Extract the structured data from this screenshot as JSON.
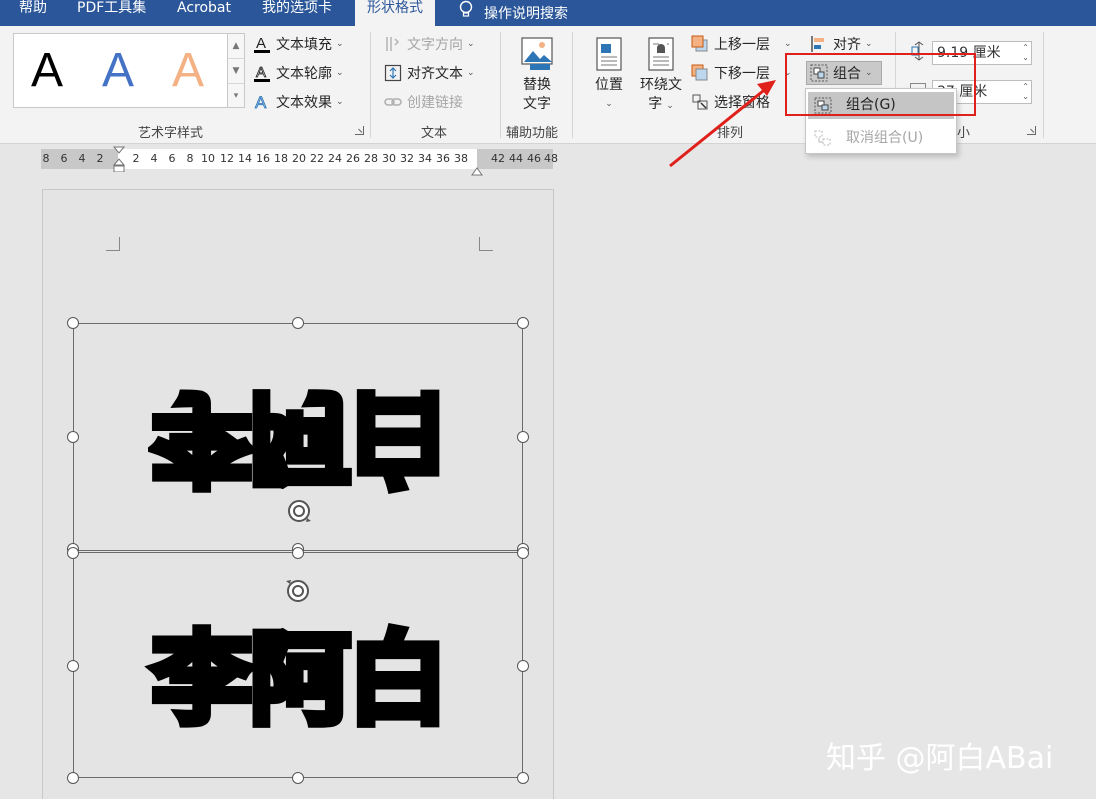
{
  "tabs": [
    {
      "label": "帮助"
    },
    {
      "label": "PDF工具集"
    },
    {
      "label": "Acrobat"
    },
    {
      "label": "我的选项卡"
    },
    {
      "label": "形状格式"
    },
    {
      "label": "操作说明搜索"
    }
  ],
  "ribbon": {
    "wordart": {
      "samples": [
        "A",
        "A",
        "A"
      ],
      "text_fill": "文本填充",
      "text_outline": "文本轮廓",
      "text_effects": "文本效果",
      "group_label": "艺术字样式"
    },
    "text": {
      "text_direction": "文字方向",
      "align_text": "对齐文本",
      "create_link": "创建链接",
      "group_label": "文本"
    },
    "accessibility": {
      "alt_text_line1": "替换",
      "alt_text_line2": "文字",
      "group_label": "辅助功能"
    },
    "arrange": {
      "position": "位置",
      "wrap_line1": "环绕文",
      "wrap_line2": "字",
      "bring_forward": "上移一层",
      "send_backward": "下移一层",
      "selection_pane": "选择窗格",
      "align": "对齐",
      "group": "组合",
      "group_label": "排列"
    },
    "size": {
      "height": "9.19 厘米",
      "width": "37 厘米",
      "group_label": "小"
    }
  },
  "group_menu": {
    "group": "组合(G)",
    "ungroup": "取消组合(U)"
  },
  "ruler_ticks": [
    "8",
    "6",
    "4",
    "2",
    "2",
    "4",
    "6",
    "8",
    "10",
    "12",
    "14",
    "16",
    "18",
    "20",
    "22",
    "24",
    "26",
    "28",
    "30",
    "32",
    "34",
    "36",
    "38",
    "42",
    "44",
    "46",
    "48"
  ],
  "document": {
    "mirrored_text": "李阿白",
    "normal_text": "李阿白"
  },
  "watermark": "知乎 @阿白ABai",
  "colors": {
    "tab_bar": "#2b579a",
    "highlight_box": "#e0201a",
    "arrow": "#e0201a"
  }
}
